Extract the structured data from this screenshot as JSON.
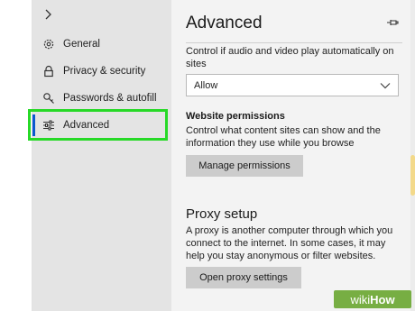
{
  "sidebar": {
    "items": [
      {
        "label": "General",
        "icon": "gear-icon"
      },
      {
        "label": "Privacy & security",
        "icon": "lock-icon"
      },
      {
        "label": "Passwords & autofill",
        "icon": "key-icon"
      },
      {
        "label": "Advanced",
        "icon": "sliders-icon",
        "selected": true
      }
    ]
  },
  "main": {
    "title": "Advanced",
    "autoplay": {
      "description": "Control if audio and video play automatically on sites",
      "selected_value": "Allow"
    },
    "website_permissions": {
      "heading": "Website permissions",
      "description": "Control what content sites can show and the information they use while you browse",
      "button_label": "Manage permissions"
    },
    "proxy": {
      "heading": "Proxy setup",
      "description": "A proxy is another computer through which you connect to the internet. In some cases, it may help you stay anonymous or filter websites.",
      "button_label": "Open proxy settings"
    }
  },
  "watermark": {
    "part1": "wiki",
    "part2": "How"
  },
  "colors": {
    "accent": "#0a58d0",
    "highlight": "#27d927",
    "nav_bg": "#e4e4e4",
    "content_bg": "#f3f3f3",
    "button_bg": "#cccccc"
  }
}
